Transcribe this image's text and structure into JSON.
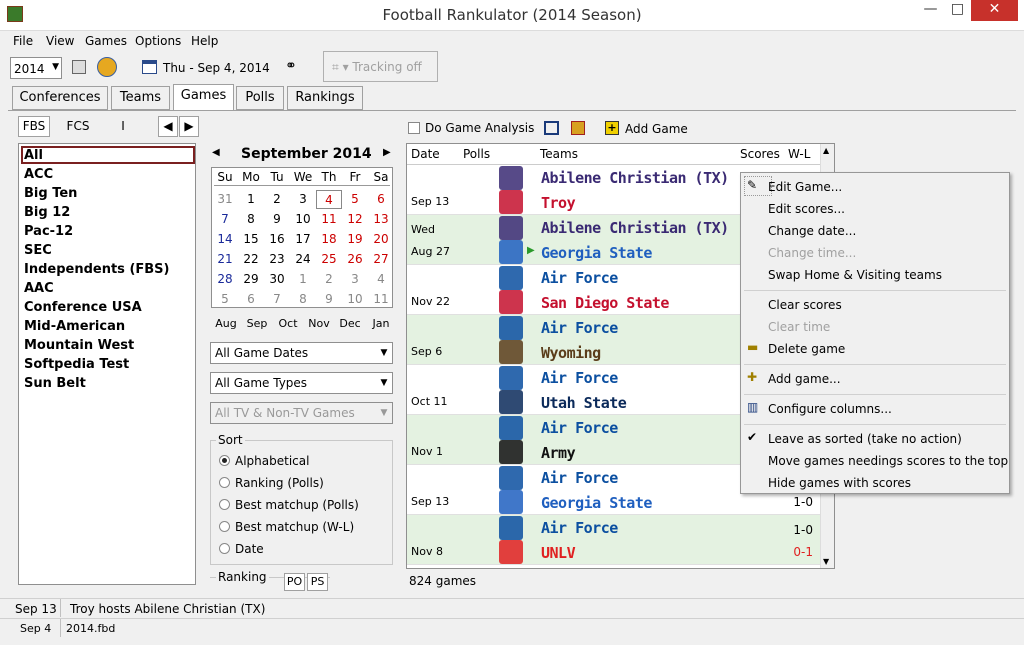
{
  "window": {
    "title": "Football Rankulator  (2014 Season)",
    "minimize": "—",
    "maximize": "□",
    "close": "✕"
  },
  "menu": [
    "File",
    "View",
    "Games",
    "Options",
    "Help"
  ],
  "toolbar": {
    "season": "2014",
    "date": "Thu - Sep 4, 2014",
    "tracking": "Tracking off"
  },
  "tabs": [
    "Conferences",
    "Teams",
    "Games",
    "Polls",
    "Rankings"
  ],
  "divisions": [
    "FBS",
    "FCS",
    "I"
  ],
  "conferences": [
    "All",
    "ACC",
    "Big Ten",
    "Big 12",
    "Pac-12",
    "SEC",
    "Independents (FBS)",
    "AAC",
    "Conference USA",
    "Mid-American",
    "Mountain West",
    "Softpedia Test",
    "Sun Belt"
  ],
  "calendar": {
    "title": "September 2014",
    "days": [
      "Su",
      "Mo",
      "Tu",
      "We",
      "Th",
      "Fr",
      "Sa"
    ],
    "weeks": [
      [
        "31",
        "1",
        "2",
        "3",
        "4",
        "5",
        "6"
      ],
      [
        "7",
        "8",
        "9",
        "10",
        "11",
        "12",
        "13"
      ],
      [
        "14",
        "15",
        "16",
        "17",
        "18",
        "19",
        "20"
      ],
      [
        "21",
        "22",
        "23",
        "24",
        "25",
        "26",
        "27"
      ],
      [
        "28",
        "29",
        "30",
        "1",
        "2",
        "3",
        "4"
      ],
      [
        "5",
        "6",
        "7",
        "8",
        "9",
        "10",
        "11"
      ]
    ],
    "months": [
      "Aug",
      "Sep",
      "Oct",
      "Nov",
      "Dec",
      "Jan"
    ]
  },
  "filters": {
    "dates": "All Game Dates",
    "types": "All Game Types",
    "tv": "All TV & Non-TV Games"
  },
  "sort": {
    "label": "Sort",
    "options": [
      "Alphabetical",
      "Ranking (Polls)",
      "Best matchup (Polls)",
      "Best matchup (W-L)",
      "Date"
    ]
  },
  "ranking": {
    "label": "Ranking",
    "po": "PO",
    "ps": "PS"
  },
  "games_toolbar": {
    "analysis": "Do Game Analysis",
    "add": "Add Game"
  },
  "grid": {
    "headers": [
      "Date",
      "Polls",
      "Teams",
      "Scores",
      "W-L"
    ],
    "count": "824 games",
    "rows": [
      {
        "d1": "",
        "d2": "Sep 13",
        "t1": "Abilene Christian (TX)",
        "t2": "Troy",
        "r1": "",
        "r2": "",
        "c1": "#3a2a73",
        "c2": "#c4102e"
      },
      {
        "d1": "Wed",
        "d2": "Aug 27",
        "t1": "Abilene Christian (TX)",
        "t2": "Georgia State",
        "r1": "",
        "r2": "",
        "c1": "#3a2a73",
        "c2": "#1f5fbf"
      },
      {
        "d1": "",
        "d2": "Nov 22",
        "t1": "Air Force",
        "t2": "San Diego State",
        "r1": "",
        "r2": "",
        "c1": "#0b4fa0",
        "c2": "#c4102e"
      },
      {
        "d1": "",
        "d2": "Sep 6",
        "t1": "Air Force",
        "t2": "Wyoming",
        "r1": "",
        "r2": "",
        "c1": "#0b4fa0",
        "c2": "#5a3d1a"
      },
      {
        "d1": "",
        "d2": "Oct 11",
        "t1": "Air Force",
        "t2": "Utah State",
        "r1": "",
        "r2": "",
        "c1": "#0b4fa0",
        "c2": "#0b2a5a"
      },
      {
        "d1": "",
        "d2": "Nov 1",
        "t1": "Air Force",
        "t2": "Army",
        "r1": "",
        "r2": "",
        "c1": "#0b4fa0",
        "c2": "#111"
      },
      {
        "d1": "",
        "d2": "Sep 13",
        "t1": "Air Force",
        "t2": "Georgia State",
        "r1": "",
        "r2": "1-0",
        "c1": "#0b4fa0",
        "c2": "#1f5fbf"
      },
      {
        "d1": "",
        "d2": "Nov 8",
        "t1": "Air Force",
        "t2": "UNLV",
        "r1": "1-0",
        "r2": "0-1",
        "c1": "#0b4fa0",
        "c2": "#e02020"
      }
    ]
  },
  "context_menu": {
    "items": [
      "Edit Game...",
      "Edit scores...",
      "Change date...",
      "Change time...",
      "Swap Home & Visiting teams",
      "Clear scores",
      "Clear time",
      "Delete game",
      "Add game...",
      "Configure columns...",
      "Leave as sorted (take no action)",
      "Move games needings scores to the top",
      "Hide games with scores"
    ]
  },
  "status": {
    "date": "Sep 13",
    "text": "Troy hosts Abilene Christian (TX)",
    "date2": "Sep 4",
    "file": "2014.fbd"
  }
}
